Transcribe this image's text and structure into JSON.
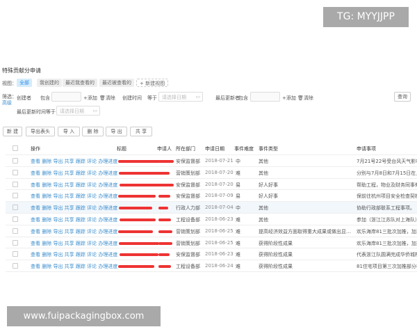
{
  "page_title": "特殊贡献分申请",
  "views": {
    "label": "视图：",
    "items": [
      "全部",
      "我创建的",
      "最近我查看的",
      "最近被查看的"
    ],
    "new_view": "+ 新建视图"
  },
  "filter": {
    "label": "筛选：",
    "advanced": "高级",
    "creator": "创建者",
    "contains": "包含",
    "add": "+添加",
    "clear": "清除",
    "created_time": "创建时间",
    "equals": "等于",
    "date_placeholder": "请选择日期",
    "last_updater": "最后更新者",
    "last_updated_time": "最后更新时间",
    "search": "查询"
  },
  "toolbar": [
    "新 建",
    "导出表头",
    "导 入",
    "删 除",
    "导 出",
    "共 享"
  ],
  "table": {
    "columns": [
      "操作",
      "标题",
      "申请人",
      "所在部门",
      "申请日期",
      "事件难度",
      "事件类型",
      "申请事项"
    ],
    "actions": "查看 删除 导出 共享 跟踪 评论 办理进度",
    "rows": [
      [
        "安保监督部",
        "2018-07-21",
        "中",
        "其他",
        "7月21号22号受台风天气影响"
      ],
      [
        "营销策划部",
        "2018-07-20",
        "难",
        "其他",
        "分别与7月8日和7月15日在上"
      ],
      [
        "安保监督部",
        "2018-07-20",
        "易",
        "好人好事",
        "帮助工程，物业及财务同事伸"
      ],
      [
        "安保监督部",
        "2018-07-09",
        "易",
        "好人好事",
        "保前往杭州项目安全检查契机"
      ],
      [
        "行政人力部",
        "2018-07-04",
        "中",
        "其他",
        "协助行政部联系工程事项。"
      ],
      [
        "工程设备部",
        "2018-06-23",
        "难",
        "其他",
        "参加（浙江江苏队对上海队）"
      ],
      [
        "营销策划部",
        "2018-06-25",
        "难",
        "提高经济效益方面取得重大成果或做出显著成...",
        "欢乐海岸81三批次加推，加推"
      ],
      [
        "营销策划部",
        "2018-06-25",
        "难",
        "获得阶段性成果",
        "欢乐海岸81三批次加推，加推"
      ],
      [
        "安保监督部",
        "2018-06-23",
        "难",
        "获得阶段性成果",
        "代表浙江队圆满完成华侨城杯"
      ],
      [
        "工程设备部",
        "2018-06-24",
        "难",
        "获得阶段性成果",
        "81住宅项目第三次加推部分楼"
      ]
    ]
  },
  "watermarks": {
    "top": "TG: MYYJJPP",
    "bottom": "www.fuipackagingbox.com"
  },
  "colors": {
    "link": "#3a8ccc",
    "redaction": "#e33333",
    "active_view": "#d6ecfa"
  }
}
